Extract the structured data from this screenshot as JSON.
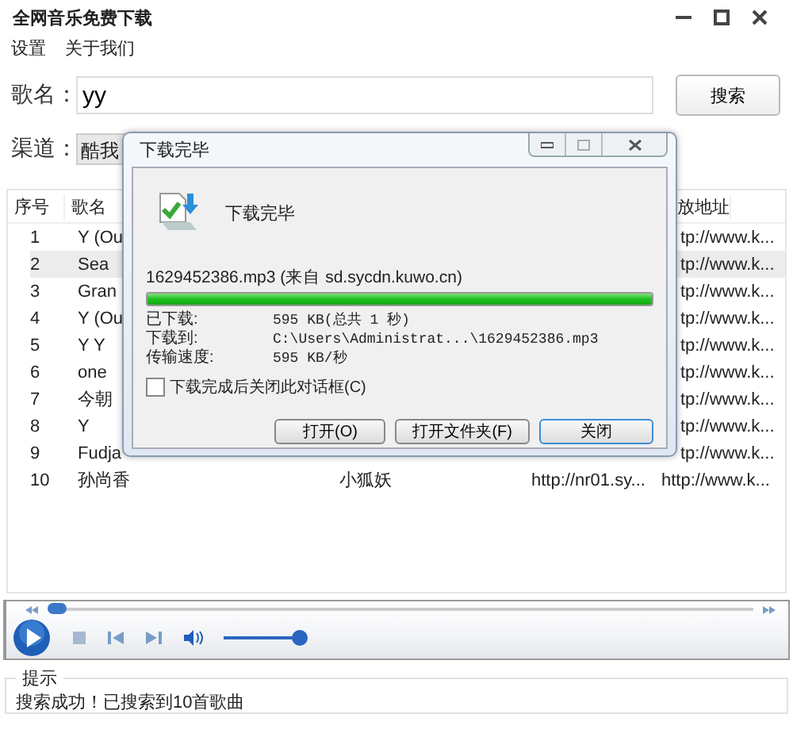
{
  "window": {
    "title": "全网音乐免费下载"
  },
  "menu": [
    "设置",
    "关于我们"
  ],
  "search": {
    "label": "歌名：",
    "value": "yy",
    "button": "搜索"
  },
  "channel": {
    "label": "渠道：",
    "value": "酷我"
  },
  "table": {
    "columns": {
      "no": "序号",
      "name": "歌名",
      "url": "放地址"
    },
    "rows": [
      {
        "no": "1",
        "name": "Y (Ou",
        "url": "tp://www.k...",
        "selected": false
      },
      {
        "no": "2",
        "name": "Sea",
        "url": "tp://www.k...",
        "selected": true
      },
      {
        "no": "3",
        "name": "Gran",
        "url": "tp://www.k...",
        "selected": false
      },
      {
        "no": "4",
        "name": "Y (Ou",
        "url": "tp://www.k...",
        "selected": false
      },
      {
        "no": "5",
        "name": "Y Y",
        "url": "tp://www.k...",
        "selected": false
      },
      {
        "no": "6",
        "name": "one",
        "url": "tp://www.k...",
        "selected": false
      },
      {
        "no": "7",
        "name": "今朝",
        "url": "tp://www.k...",
        "selected": false
      },
      {
        "no": "8",
        "name": "Y",
        "url": "tp://www.k...",
        "selected": false
      },
      {
        "no": "9",
        "name": "Fudja",
        "url": "tp://www.k...",
        "selected": false
      },
      {
        "no": "10",
        "name": "孙尚香",
        "column_3": "小狐妖",
        "column_4": "http://nr01.sy...",
        "url": "http://www.k...",
        "selected": false
      }
    ]
  },
  "player": {
    "seek": {
      "level": 0
    },
    "volume": {
      "level": 1
    }
  },
  "hint": {
    "legend": "提示",
    "message": "搜索成功！已搜索到10首歌曲"
  },
  "dialog": {
    "title": "下载完毕",
    "heading": "下载完毕",
    "file": "1629452386.mp3 (来自 sd.sycdn.kuwo.cn)",
    "level": 1,
    "details": [
      {
        "label": "已下载:",
        "value": "595 KB(总共 1 秒)"
      },
      {
        "label": "下载到:",
        "value": "C:\\Users\\Administrat...\\1629452386.mp3"
      },
      {
        "label": "传输速度:",
        "value": "595 KB/秒"
      }
    ],
    "checkbox": {
      "label": "下载完成后关闭此对话框(C)",
      "checked": false
    },
    "buttons": [
      {
        "label": "打开(O)",
        "focused": false
      },
      {
        "label": "打开文件夹(F)",
        "focused": false
      },
      {
        "label": "关闭",
        "focused": true
      }
    ]
  }
}
